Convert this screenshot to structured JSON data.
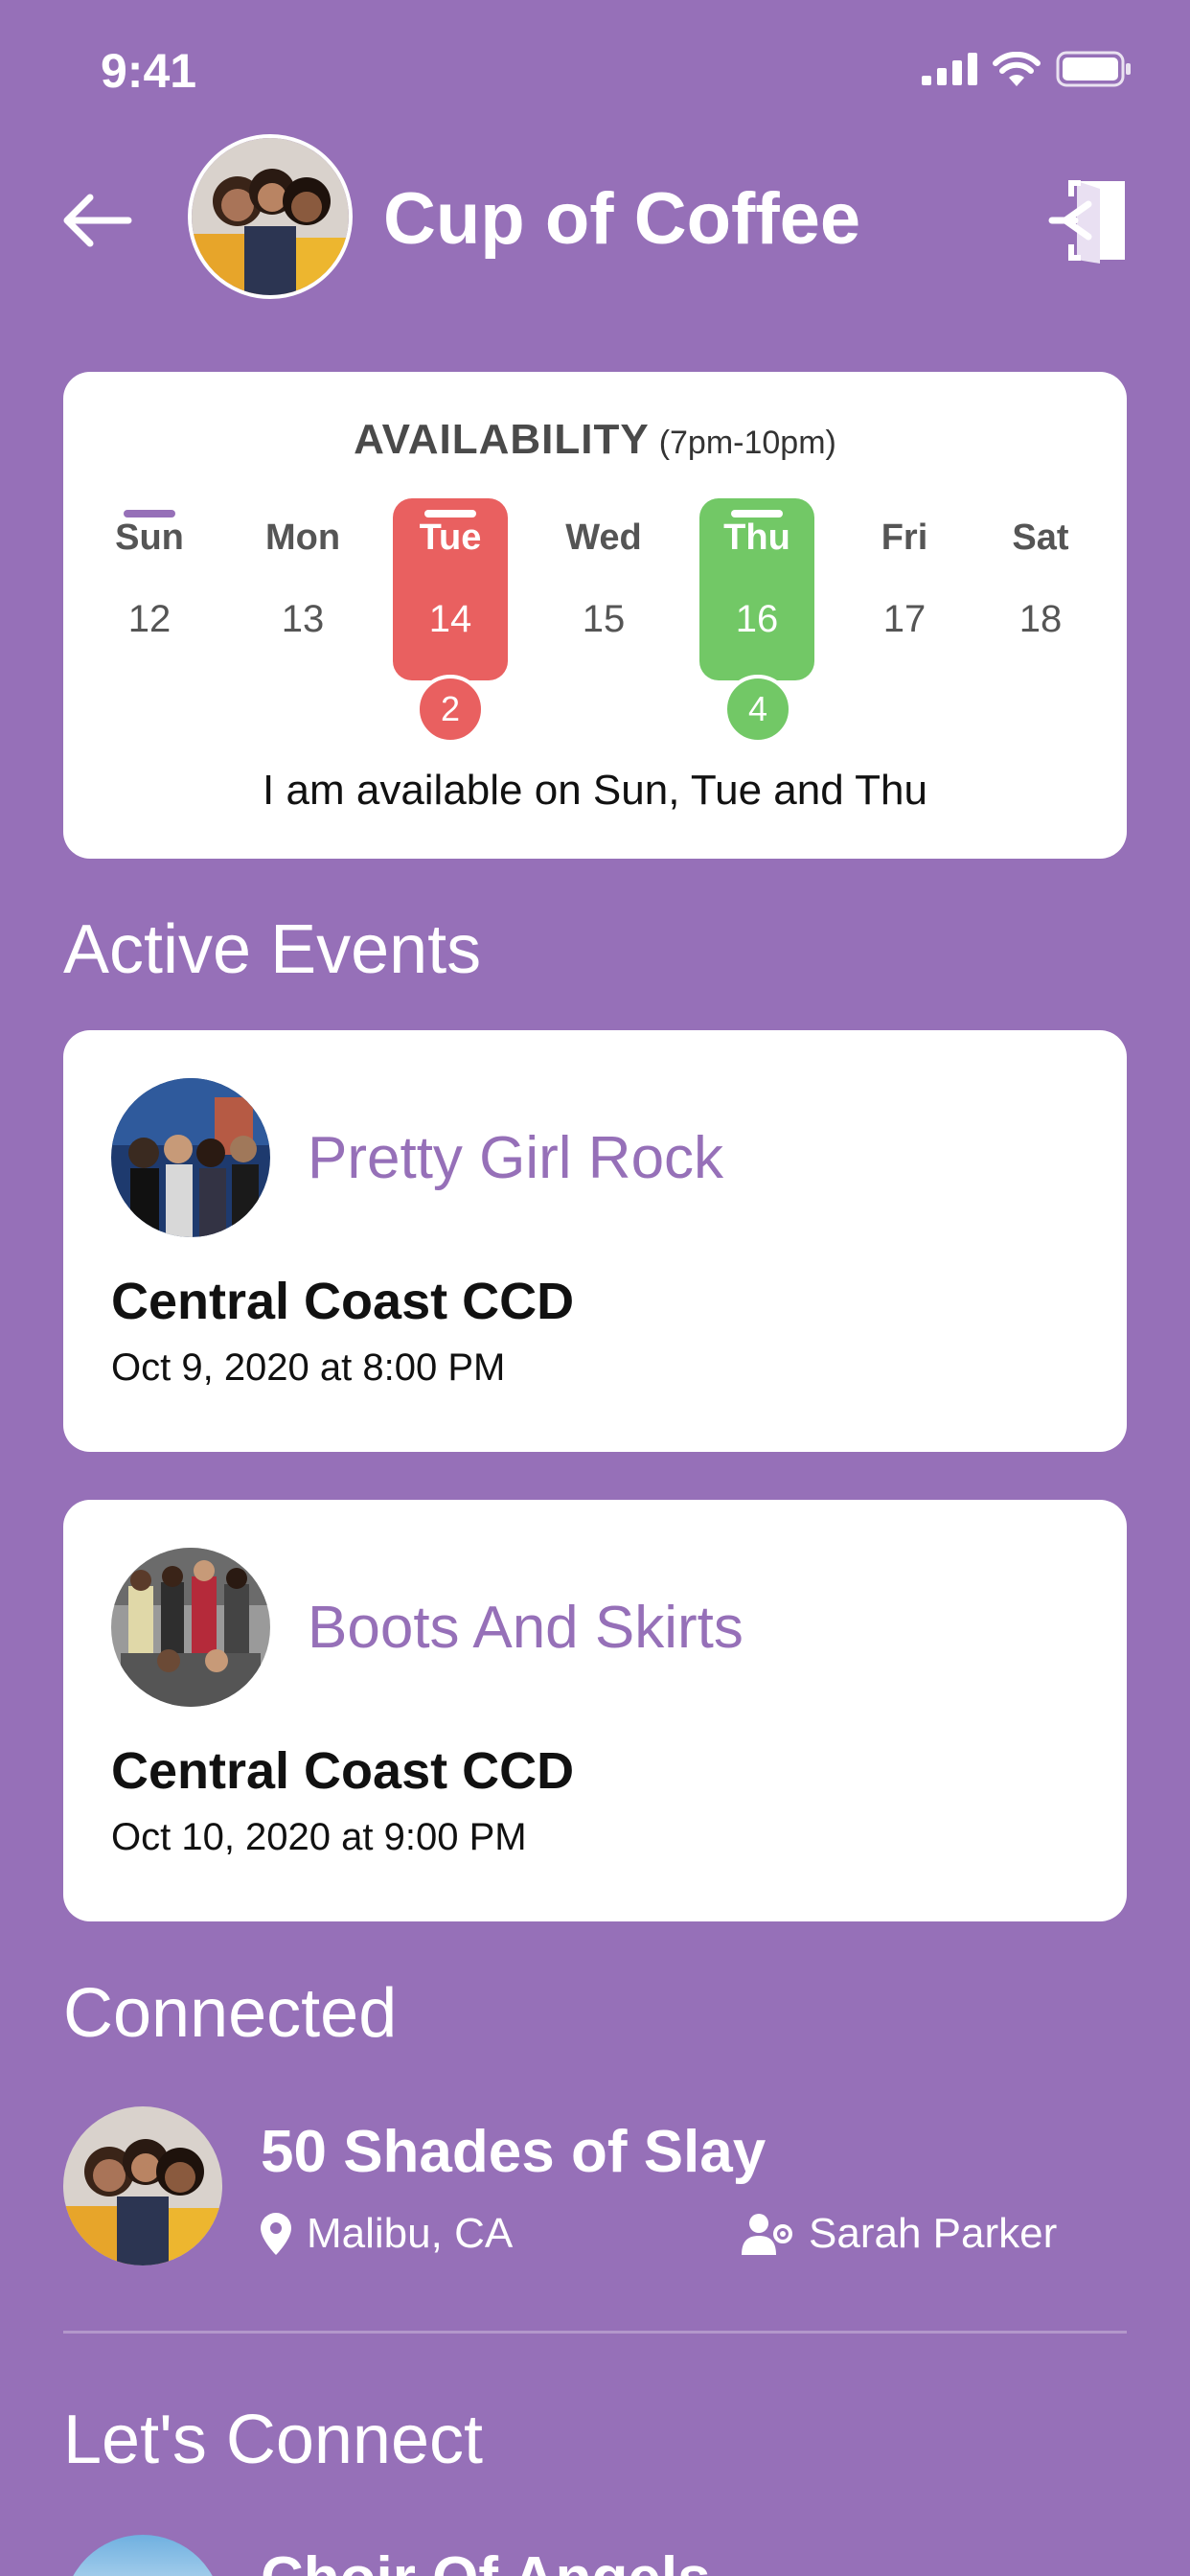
{
  "status": {
    "time": "9:41"
  },
  "header": {
    "title": "Cup of Coffee"
  },
  "availability": {
    "title": "AVAILABILITY",
    "hours": "(7pm-10pm)",
    "days": [
      {
        "name": "Sun",
        "num": "12"
      },
      {
        "name": "Mon",
        "num": "13"
      },
      {
        "name": "Tue",
        "num": "14",
        "count": "2"
      },
      {
        "name": "Wed",
        "num": "15"
      },
      {
        "name": "Thu",
        "num": "16",
        "count": "4"
      },
      {
        "name": "Fri",
        "num": "17"
      },
      {
        "name": "Sat",
        "num": "18"
      }
    ],
    "note": "I am available on Sun, Tue and Thu",
    "colors": {
      "red": "#E96060",
      "green": "#72C866",
      "accent": "#9670B8"
    }
  },
  "active_events": {
    "title": "Active Events",
    "items": [
      {
        "group": "Pretty Girl Rock",
        "venue": "Central Coast CCD",
        "date": "Oct 9, 2020 at 8:00 PM"
      },
      {
        "group": "Boots And Skirts",
        "venue": "Central Coast CCD",
        "date": "Oct 10, 2020 at 9:00 PM"
      }
    ]
  },
  "connected": {
    "title": "Connected",
    "items": [
      {
        "name": "50 Shades of Slay",
        "location": "Malibu, CA",
        "leader": "Sarah Parker"
      }
    ]
  },
  "lets_connect": {
    "title": "Let's Connect",
    "items": [
      {
        "name": "Choir Of Angels"
      }
    ]
  }
}
